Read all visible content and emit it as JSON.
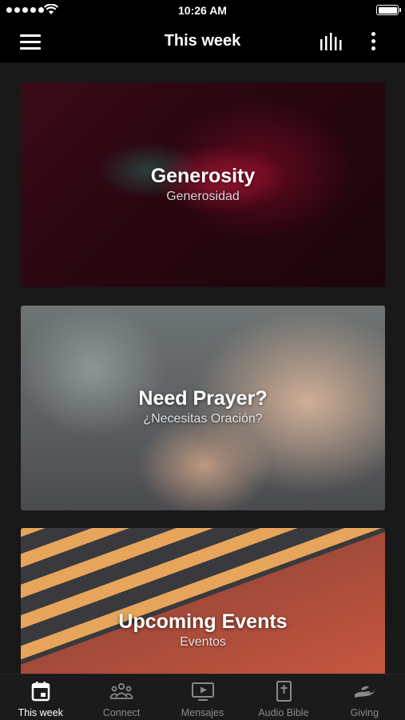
{
  "status_bar": {
    "time": "10:26 AM"
  },
  "nav": {
    "title": "This week",
    "menu_icon": "hamburger-menu-icon",
    "audio_icon": "audio-levels-icon",
    "more_icon": "more-vertical-icon"
  },
  "cards": [
    {
      "title": "Generosity",
      "subtitle": "Generosidad"
    },
    {
      "title": "Need Prayer?",
      "subtitle": "¿Necesitas Oración?"
    },
    {
      "title": "Upcoming Events",
      "subtitle": "Eventos"
    }
  ],
  "tabs": [
    {
      "label": "This week",
      "icon": "calendar-icon",
      "active": true
    },
    {
      "label": "Connect",
      "icon": "people-icon",
      "active": false
    },
    {
      "label": "Mensajes",
      "icon": "tv-play-icon",
      "active": false
    },
    {
      "label": "Audio Bible",
      "icon": "bible-icon",
      "active": false
    },
    {
      "label": "Giving",
      "icon": "hand-giving-icon",
      "active": false
    }
  ],
  "colors": {
    "background": "#000000",
    "content_background": "#181818",
    "tab_bar": "#1b1b1b",
    "tab_inactive": "#8a8a8a",
    "tab_active": "#ffffff"
  }
}
